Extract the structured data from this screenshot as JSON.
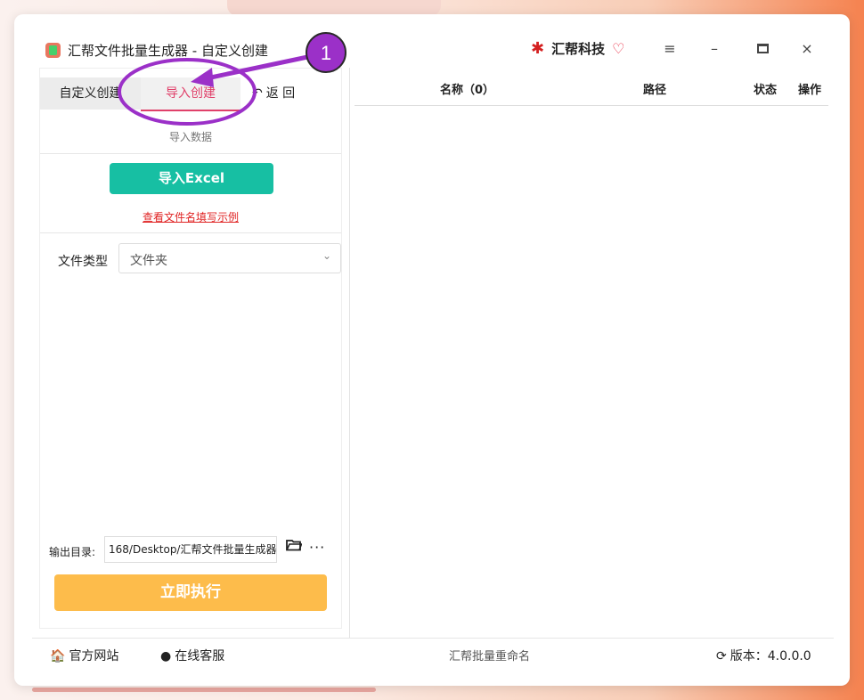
{
  "window": {
    "title": "汇帮文件批量生成器 - 自定义创建"
  },
  "brand": {
    "name": "汇帮科技"
  },
  "controls": {
    "menu": "≡",
    "minimize": "–",
    "close": "×"
  },
  "tabs": {
    "custom": "自定义创建",
    "import": "导入创建",
    "back": "返 回"
  },
  "import_section": {
    "label": "导入数据",
    "import_button": "导入Excel",
    "example_link": "查看文件名填写示例"
  },
  "file_type": {
    "label": "文件类型",
    "selected": "文件夹"
  },
  "output": {
    "label": "输出目录:",
    "value": "168/Desktop/汇帮文件批量生成器",
    "more": "···"
  },
  "run_button": "立即执行",
  "table": {
    "columns": {
      "name": "名称（0）",
      "path": "路径",
      "status": "状态",
      "op": "操作"
    }
  },
  "statusbar": {
    "site": "官方网站",
    "service": "在线客服",
    "center": "汇帮批量重命名",
    "version": "版本：4.0.0.0"
  },
  "annotation": {
    "step": "1",
    "color": "#9b30c8"
  },
  "colors": {
    "accent": "#e0406a",
    "excel": "#17bfa3",
    "run": "#fdbc4b",
    "link": "#e02424"
  }
}
